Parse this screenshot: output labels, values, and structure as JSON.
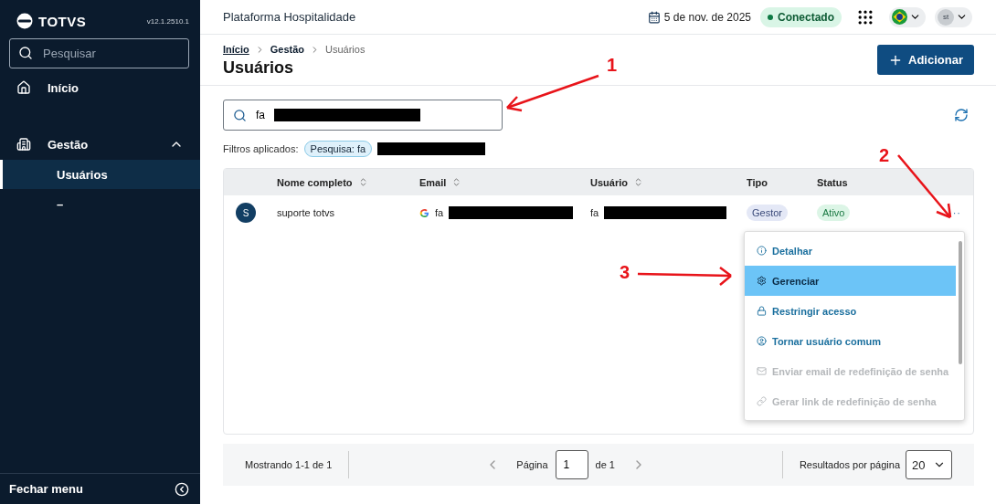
{
  "sidebar": {
    "logo": "TOTVS",
    "version": "v12.1.2510.1",
    "search_placeholder": "Pesquisar",
    "items": [
      {
        "label": "Início"
      },
      {
        "label": "Gestão",
        "expanded": true,
        "children": [
          {
            "label": "Usuários",
            "selected": true
          },
          {
            "label": "–",
            "selected": false
          }
        ]
      }
    ],
    "footer": "Fechar menu"
  },
  "header": {
    "title": "Plataforma Hospitalidade",
    "date": "5 de nov. de 2025",
    "status": "Conectado",
    "avatar": "st"
  },
  "breadcrumb": [
    {
      "label": "Início",
      "kind": "link"
    },
    {
      "label": "Gestão",
      "kind": "bold"
    },
    {
      "label": "Usuários",
      "kind": "current"
    }
  ],
  "page_title": "Usuários",
  "add_button": "Adicionar",
  "search": {
    "value": "fa",
    "redacted": true
  },
  "filters": {
    "label": "Filtros aplicados:",
    "chips": [
      {
        "text": "Pesquisa: fa",
        "redacted": true
      }
    ]
  },
  "table": {
    "columns": [
      {
        "label": "Nome completo",
        "sortable": true
      },
      {
        "label": "Email",
        "sortable": true
      },
      {
        "label": "Usuário",
        "sortable": true
      },
      {
        "label": "Tipo",
        "sortable": false
      },
      {
        "label": "Status",
        "sortable": false
      }
    ],
    "rows": [
      {
        "initial": "S",
        "name": "suporte totvs",
        "email": {
          "value": "fa",
          "redacted": true
        },
        "user": {
          "value": "fa",
          "redacted": true
        },
        "type": "Gestor",
        "status": "Ativo",
        "actions": "···"
      }
    ]
  },
  "menu": [
    {
      "label": "Detalhar",
      "selected": false,
      "disabled": false
    },
    {
      "label": "Gerenciar",
      "selected": true,
      "disabled": false
    },
    {
      "label": "Restringir acesso",
      "selected": false,
      "disabled": false
    },
    {
      "label": "Tornar usuário comum",
      "selected": false,
      "disabled": false
    },
    {
      "label": "Enviar email de redefinição de senha",
      "selected": false,
      "disabled": true
    },
    {
      "label": "Gerar link de redefinição de senha",
      "selected": false,
      "disabled": true
    }
  ],
  "pagination": {
    "showing": "Mostrando 1-1 de 1",
    "page_label": "Página",
    "page": "1",
    "of": "de 1",
    "per_page_label": "Resultados por página",
    "per_page": "20"
  },
  "annotations": [
    {
      "number": "1"
    },
    {
      "number": "2"
    },
    {
      "number": "3"
    }
  ]
}
